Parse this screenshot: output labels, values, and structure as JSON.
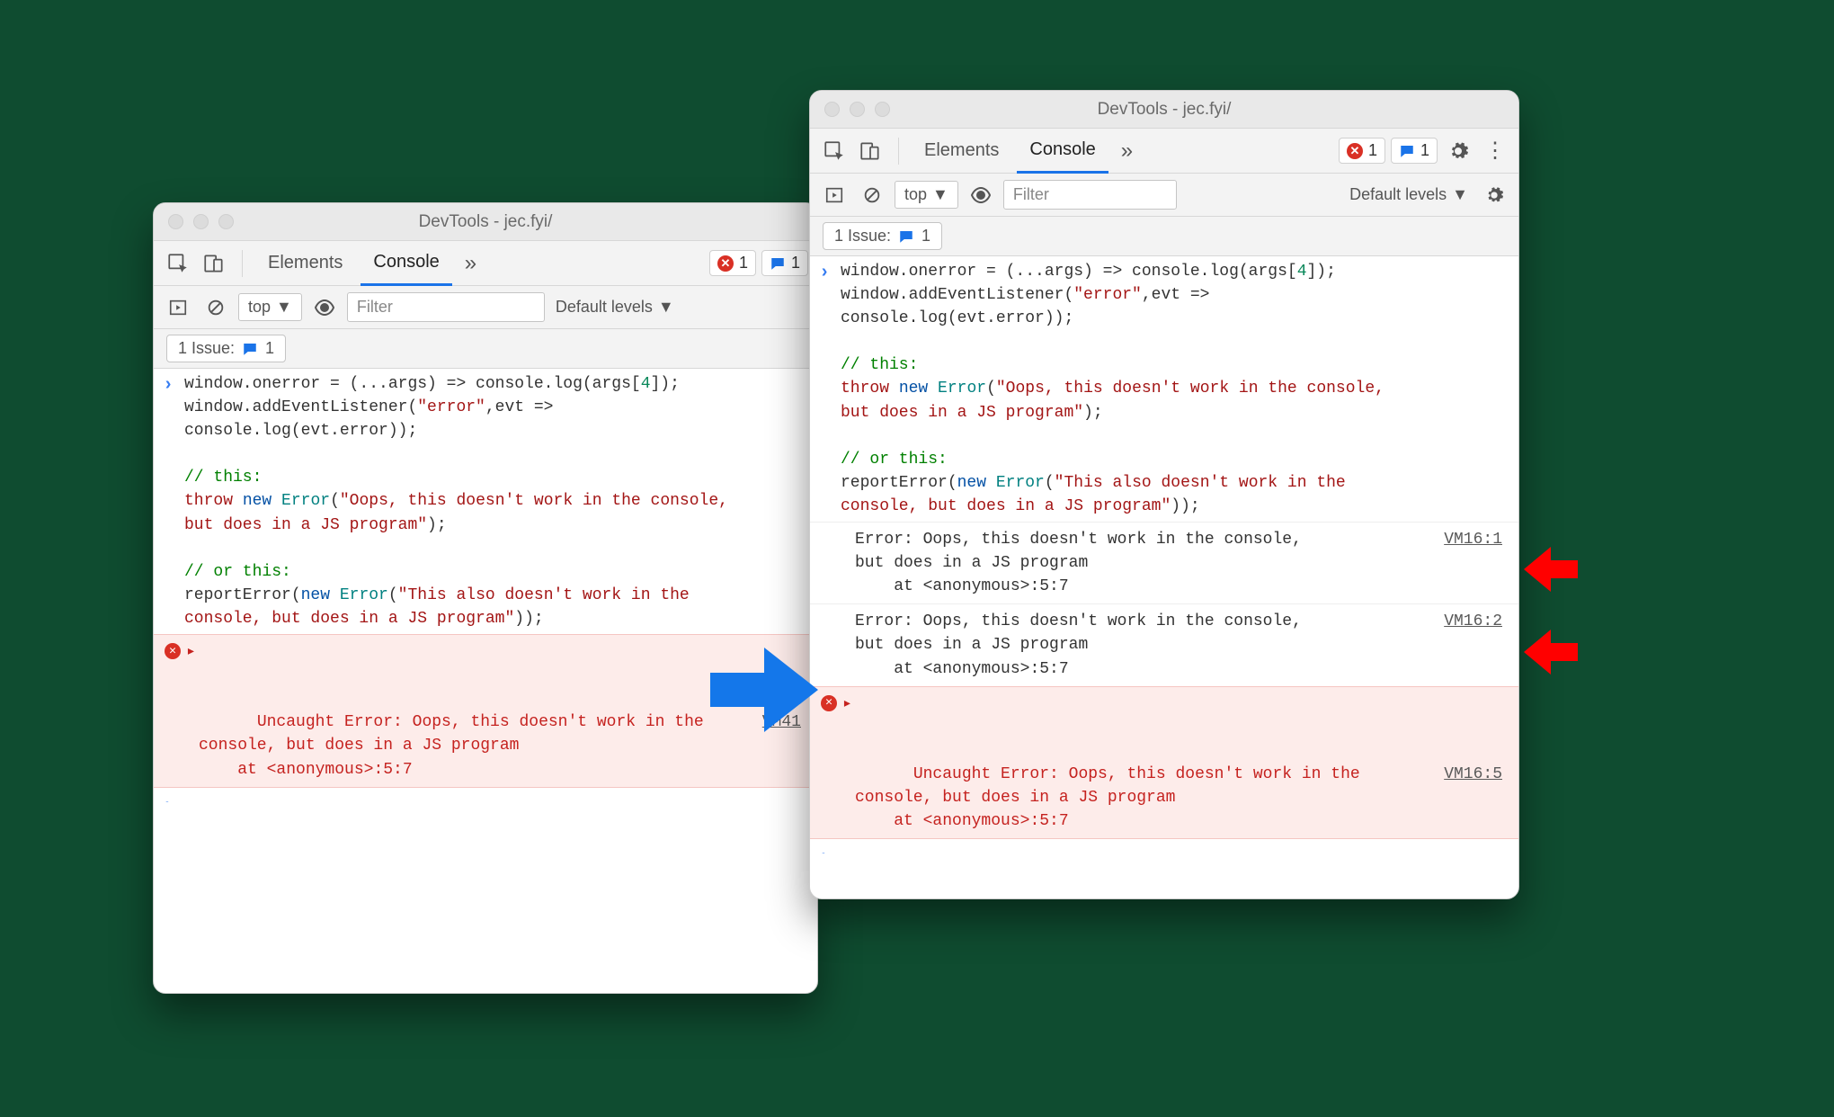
{
  "window_title": "DevTools - jec.fyi/",
  "tabs": {
    "elements": "Elements",
    "console": "Console"
  },
  "badges": {
    "errors": "1",
    "messages": "1"
  },
  "toolbar": {
    "context": "top",
    "filter_placeholder": "Filter",
    "levels": "Default levels"
  },
  "issues": {
    "label": "1 Issue:",
    "count": "1"
  },
  "code": {
    "l1a": "window.onerror = (...args) => console.log(args[",
    "l1b": "4",
    "l1c": "]);",
    "l2a": "window.addEventListener(",
    "l2b": "\"error\"",
    "l2c": ",evt =>",
    "l3": "console.log(evt.error));",
    "c1": "// this:",
    "t1a": "throw",
    "t1b": "new",
    "t1c": "Error",
    "t1d": "(",
    "t1e": "\"Oops, this doesn't work in the console,",
    "t1f": "but does in a JS program\"",
    "t1g": ");",
    "c2": "// or this:",
    "r1a": "reportError(",
    "r1b": "new",
    "r1c": "Error",
    "r1d": "(",
    "r1e": "\"This also doesn't work in the",
    "r1f": "console, but does in a JS program\"",
    "r1g": "));"
  },
  "left": {
    "err_src": "VM41",
    "err_l1": "Uncaught Error: Oops, this doesn't work in the",
    "err_l2": "console, but does in a JS program",
    "err_l3": "    at <anonymous>:5:7"
  },
  "right": {
    "log1_src": "VM16:1",
    "log2_src": "VM16:2",
    "err_src": "VM16:5",
    "log_l1": "Error: Oops, this doesn't work in the console,",
    "log_l2": "but does in a JS program",
    "log_l3": "    at <anonymous>:5:7",
    "err_l1": "Uncaught Error: Oops, this doesn't work in the",
    "err_l2": "console, but does in a JS program",
    "err_l3": "    at <anonymous>:5:7"
  }
}
